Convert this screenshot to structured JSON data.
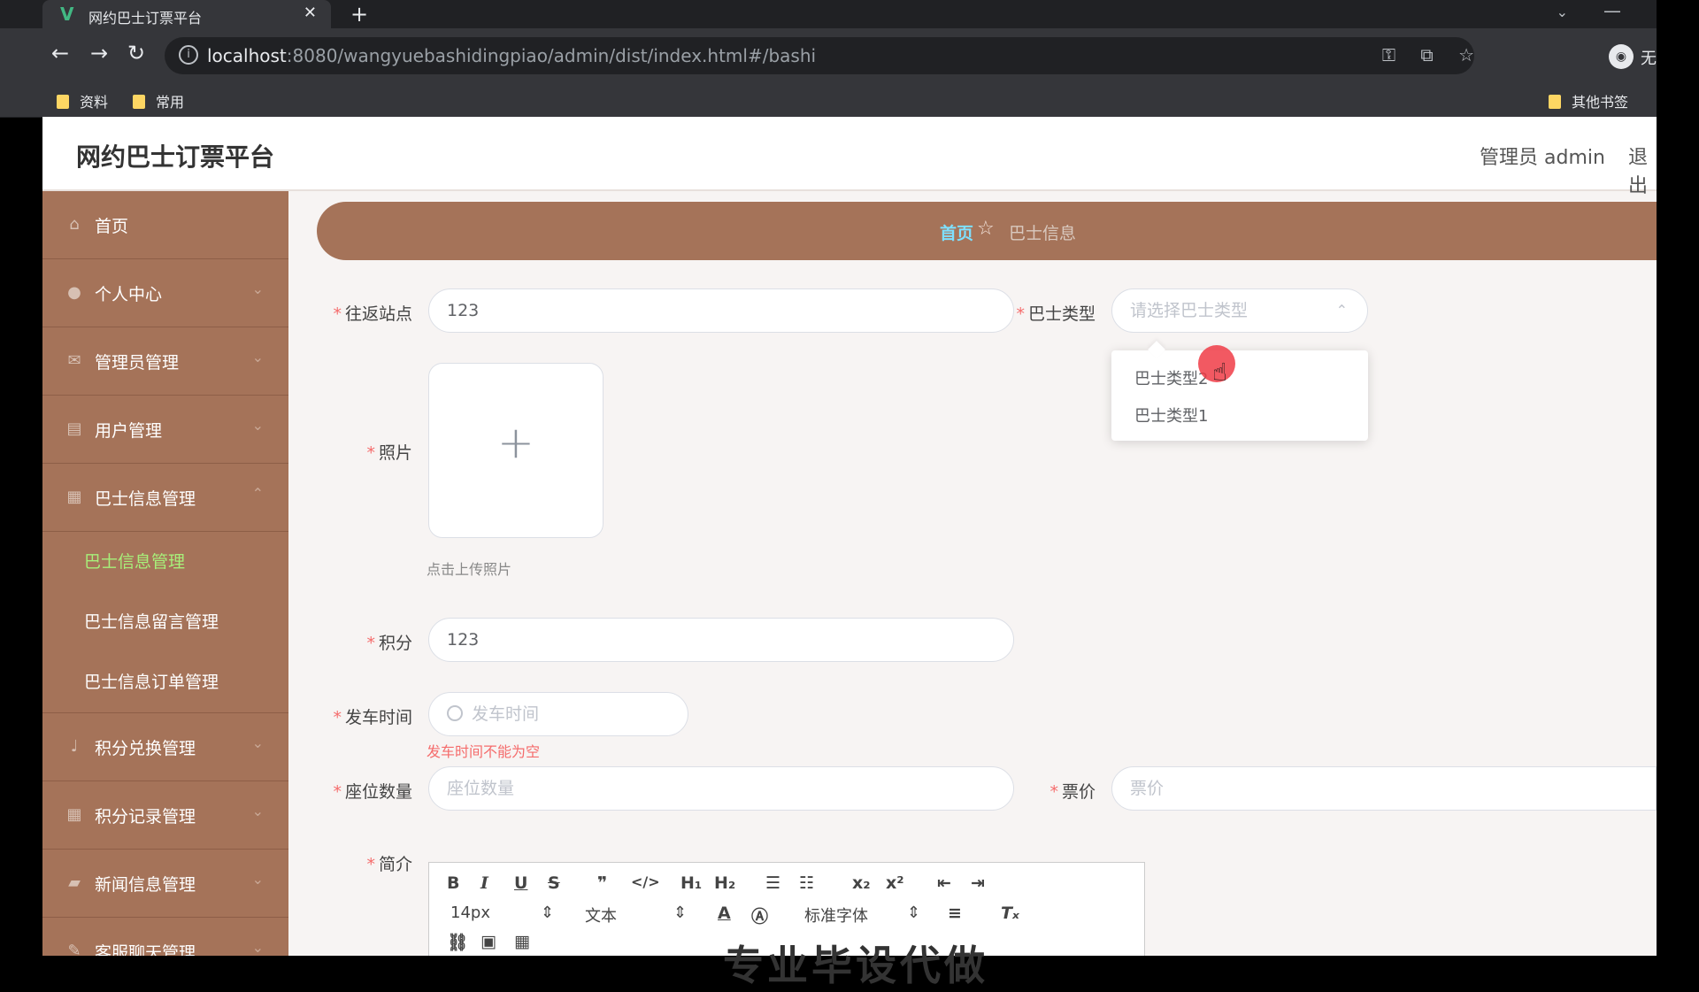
{
  "browser": {
    "tab_title": "网约巴士订票平台",
    "tab_logo": "V",
    "url_host": "localhost",
    "url_path": ":8080/wangyuebashidingpiao/admin/dist/index.html#/bashi",
    "profile_label": "无",
    "bookmarks": [
      "资料",
      "常用"
    ],
    "other_bookmarks": "其他书签"
  },
  "header": {
    "title": "网约巴士订票平台",
    "user": "管理员 admin",
    "logout": "退出"
  },
  "sidebar": {
    "items": [
      {
        "label": "首页",
        "icon": "home-icon"
      },
      {
        "label": "个人中心",
        "icon": "user-icon"
      },
      {
        "label": "管理员管理",
        "icon": "mail-icon"
      },
      {
        "label": "用户管理",
        "icon": "clipboard-icon"
      },
      {
        "label": "巴士信息管理",
        "icon": "chart-icon"
      },
      {
        "label": "积分兑换管理",
        "icon": "mic-icon"
      },
      {
        "label": "积分记录管理",
        "icon": "grid-icon"
      },
      {
        "label": "新闻信息管理",
        "icon": "news-icon"
      },
      {
        "label": "客服聊天管理",
        "icon": "chat-icon"
      }
    ],
    "submenu": [
      "巴士信息管理",
      "巴士信息留言管理",
      "巴士信息订单管理"
    ]
  },
  "breadcrumb": {
    "home": "首页",
    "current": "巴士信息"
  },
  "form": {
    "station": {
      "label": "往返站点",
      "value": "123"
    },
    "bus_type": {
      "label": "巴士类型",
      "placeholder": "请选择巴士类型",
      "options": [
        "巴士类型2",
        "巴士类型1"
      ]
    },
    "photo": {
      "label": "照片",
      "tip": "点击上传照片"
    },
    "points": {
      "label": "积分",
      "value": "123"
    },
    "depart_time": {
      "label": "发车时间",
      "placeholder": "发车时间",
      "error": "发车时间不能为空"
    },
    "seats": {
      "label": "座位数量",
      "placeholder": "座位数量"
    },
    "price": {
      "label": "票价",
      "placeholder": "票价"
    },
    "intro": {
      "label": "简介"
    }
  },
  "editor": {
    "font_size": "14px",
    "format": "文本",
    "font_family": "标准字体",
    "content_preview": "专业毕设代做"
  },
  "colors": {
    "sidebar": "#a57359",
    "active_sub": "#a7f07a",
    "required": "#f56c6c"
  }
}
